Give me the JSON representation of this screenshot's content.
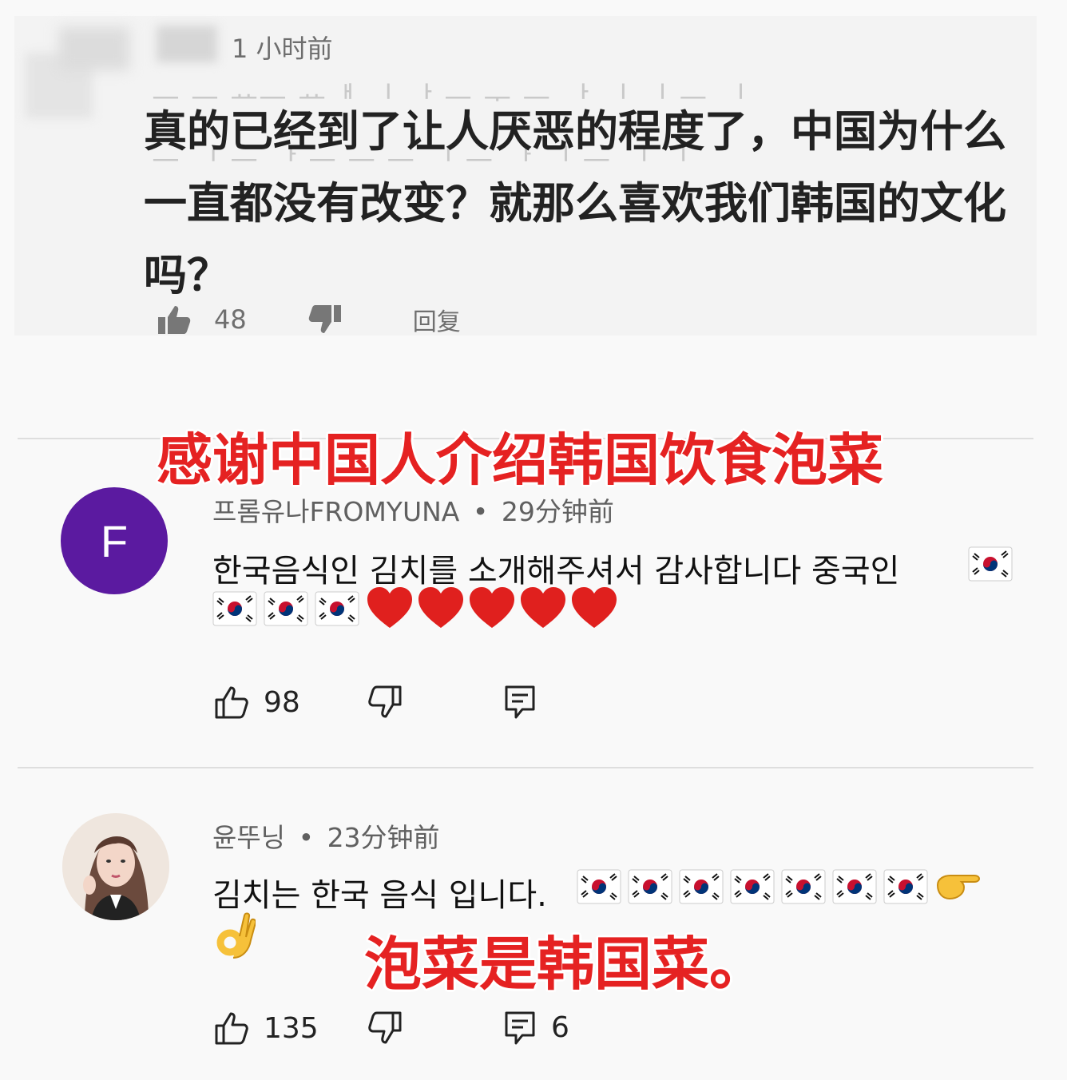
{
  "top_comment": {
    "time": "1 小时前",
    "body": "真的已经到了让人厌恶的程度了，中国为什么一直都没有改变？就那么喜欢我们韩国的文化吗？",
    "likes": "48",
    "reply_label": "回复"
  },
  "captions": {
    "caption_1": "感谢中国人介绍韩国饮食泡菜",
    "caption_2": "泡菜是韩国菜。"
  },
  "comments": [
    {
      "avatar_letter": "F",
      "author": "프롬유나FROMYUNA",
      "separator": "•",
      "time": "29分钟前",
      "text": "한국음식인 김치를 소개해주셔서 감사합니다 중국인",
      "likes": "98"
    },
    {
      "author": "윤뚜닝",
      "separator": "•",
      "time": "23分钟前",
      "text": "김치는 한국 음식 입니다.",
      "likes": "135",
      "replies": "6"
    }
  ],
  "colors": {
    "caption_red": "#e52222",
    "avatar_purple": "#5b1aa0"
  }
}
